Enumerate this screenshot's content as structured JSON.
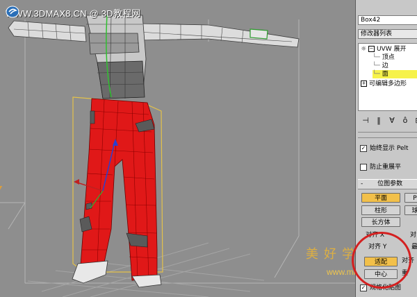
{
  "watermark": {
    "text": "WWW.3DMAX8.CN @ 3D教程网",
    "logo_icon": "swirl-logo-icon"
  },
  "site_watermark": {
    "chinese": "美好学习",
    "url": "www.mlzc.cn",
    "color": "#e6b33a"
  },
  "panel": {
    "object_name": "Box42",
    "modifier_list": "修改器列表",
    "stack": [
      {
        "label": "UVW 展开",
        "level": 0,
        "expand": "−",
        "icon": "lightbulb-icon"
      },
      {
        "label": "顶点",
        "level": 1
      },
      {
        "label": "边",
        "level": 1
      },
      {
        "label": "面",
        "level": 1,
        "selected": true
      },
      {
        "label": "可编辑多边形",
        "level": 0,
        "expand": "+"
      }
    ],
    "stack_tools": [
      "pin-stack-icon",
      "show-end-result-icon",
      "make-unique-icon",
      "remove-modifier-icon",
      "configure-sets-icon"
    ],
    "checkbox_always_show": "始终显示 Pelt",
    "checkbox_prevent_reflatten": "防止重展平",
    "rollout_title": "位图参数",
    "rollout_collapse": "-",
    "map_buttons": {
      "planar": "平面",
      "planar_right": "P",
      "cylindrical": "柱形",
      "cylindrical_right": "球",
      "box": "长方体"
    },
    "align_x": "对齐 X",
    "align_x_right": "对",
    "align_y": "对齐 Y",
    "align_y_right": "最",
    "fit_button": "适配",
    "fit_right": "对齐",
    "center_button": "中心",
    "center_right": "重",
    "normalize_map": "规格化贴图"
  },
  "colors": {
    "viewport_bg": "#8e8e8e",
    "pants": "#e01818",
    "selection_box": "#e4c24a",
    "highlight": "#f6f24a",
    "active_button": "#f2c04a"
  }
}
